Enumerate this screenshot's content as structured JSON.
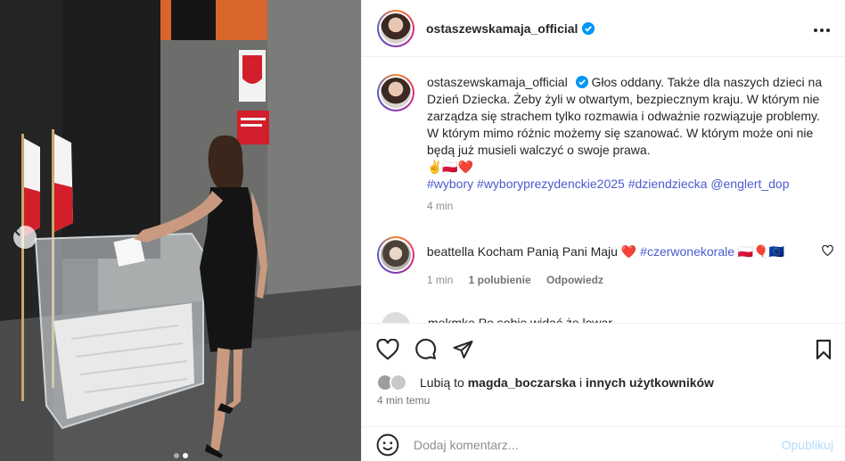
{
  "post": {
    "author": "ostaszewskamaja_official",
    "more_icon": "more-horizontal-icon",
    "caption": {
      "author": "ostaszewskamaja_official",
      "text": "Głos oddany. Także dla naszych dzieci na Dzień Dziecka. Żeby żyli w otwartym, bezpiecznym kraju. W którym nie zarządza się strachem tylko rozmawia i odważnie rozwiązuje problemy. W którym mimo różnic możemy się szanować. W którym może oni nie będą już musieli walczyć o swoje prawa.",
      "emojis": "✌🇵🇱❤️",
      "hashtags": [
        "#wybory",
        "#wyboryprezydenckie2025",
        "#dziendziecka",
        "@englert_dop"
      ],
      "time": "4 min"
    },
    "comments": [
      {
        "user": "beattella",
        "text": "Kocham Panią Pani Maju",
        "heart": "❤️",
        "hashtag": "#czerwonekorale",
        "emojis": "🇵🇱🎈🇪🇺",
        "time": "1 min",
        "likes": "1 polubienie",
        "reply": "Odpowiedz"
      }
    ],
    "partial_comment": "mekmke Po sobie widać że lewar...",
    "likes": {
      "prefix": "Lubią to",
      "user": "magda_boczarska",
      "connector": "i",
      "rest": "innych użytkowników"
    },
    "posted_ago": "4 min temu",
    "add_comment": {
      "placeholder": "Dodaj komentarz...",
      "publish": "Opublikuj"
    }
  },
  "icons": {
    "verified": "verified-badge-icon",
    "like": "heart-icon",
    "comment": "comment-icon",
    "share": "share-icon",
    "save": "bookmark-icon",
    "emoji": "emoji-icon",
    "carousel_prev": "chevron-left-icon"
  },
  "colors": {
    "verified": "#0095f6",
    "link": "#00376b",
    "hashtag": "#4a5bd0",
    "publish_disabled": "#b3dbff",
    "heart": "#e0245e"
  },
  "carousel": {
    "count": 2,
    "active": 2
  }
}
